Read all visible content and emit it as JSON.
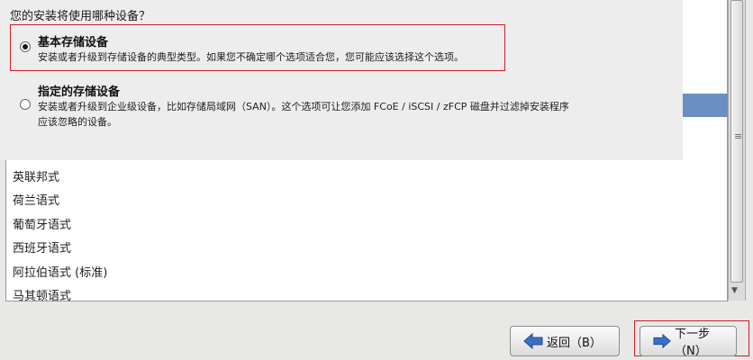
{
  "storage": {
    "question": "您的安装将使用哪种设备？",
    "options": [
      {
        "title": "基本存储设备",
        "description_lines": [
          "安装或者升级到存储设备的典型类型。如果您不确定哪个选项适合您，您可能应该选择这个选项。"
        ],
        "selected": true
      },
      {
        "title": "指定的存储设备",
        "description_lines": [
          "安装或者升级到企业级设备，比如存储局域网（SAN）。这个选项可让您添加 FCoE / iSCSI / zFCP 磁盘并过滤掉安装程序",
          "应该忽略的设备。"
        ],
        "selected": false
      }
    ]
  },
  "language_list": {
    "items": [
      "英联邦式",
      "荷兰语式",
      "葡萄牙语式",
      "西班牙语式",
      "阿拉伯语式 (标准)",
      "马其顿语式"
    ]
  },
  "buttons": {
    "back_label": "返回（B）",
    "next_label": "下一步（N）"
  },
  "colors": {
    "highlight_outline": "#d01c28",
    "selection_blue": "#6a8fc0",
    "arrow_blue": "#3a6fc4"
  }
}
